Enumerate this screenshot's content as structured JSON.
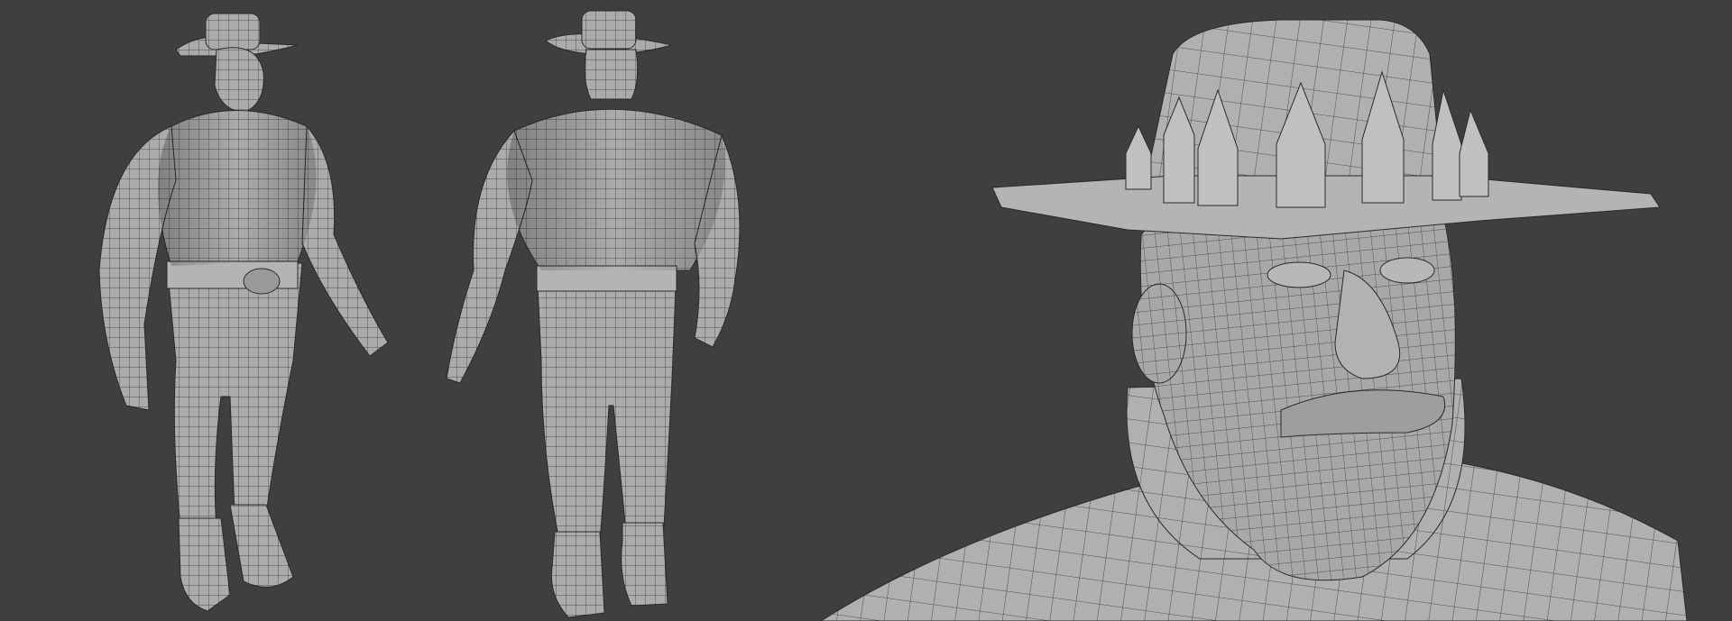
{
  "scene": {
    "background_color": "#3f3f3f",
    "mesh_color": "#a9a9a9",
    "wire_color": "#2a2a2a",
    "views": [
      "front-three-quarter",
      "back-three-quarter",
      "head-closeup"
    ]
  }
}
